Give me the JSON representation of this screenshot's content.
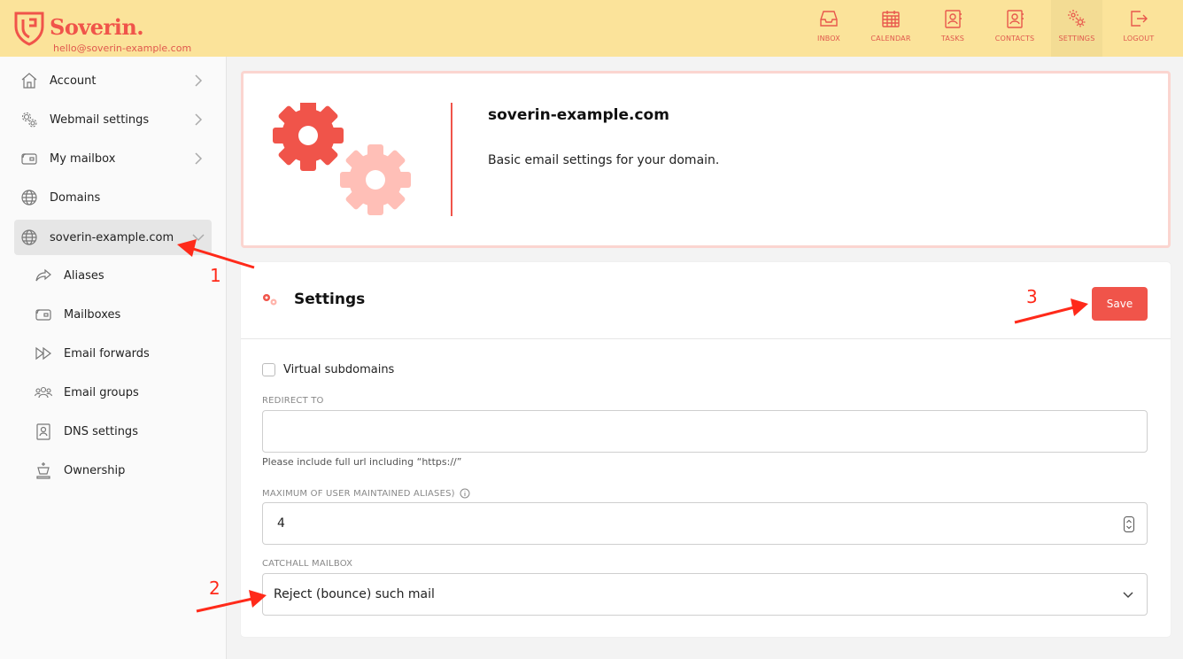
{
  "brand": {
    "name": "Soverin.",
    "email": "hello@soverin-example.com",
    "color": "#f0544a"
  },
  "nav": [
    {
      "label": "INBOX",
      "icon": "inbox-icon"
    },
    {
      "label": "CALENDAR",
      "icon": "calendar-icon"
    },
    {
      "label": "TASKS",
      "icon": "tasks-icon"
    },
    {
      "label": "CONTACTS",
      "icon": "contacts-icon"
    },
    {
      "label": "SETTINGS",
      "icon": "settings-icon",
      "active": true
    },
    {
      "label": "LOGOUT",
      "icon": "logout-icon"
    }
  ],
  "sidebar": {
    "items": [
      {
        "label": "Account",
        "icon": "home-icon"
      },
      {
        "label": "Webmail settings",
        "icon": "gears-icon"
      },
      {
        "label": "My mailbox",
        "icon": "mailbox-icon"
      },
      {
        "label": "Domains",
        "icon": "globe-icon"
      },
      {
        "label": "soverin-example.com",
        "icon": "globe-icon",
        "active": true
      }
    ],
    "subitems": [
      {
        "label": "Aliases",
        "icon": "share-arrow-icon"
      },
      {
        "label": "Mailboxes",
        "icon": "mailbox-icon"
      },
      {
        "label": "Email forwards",
        "icon": "fast-forward-icon"
      },
      {
        "label": "Email groups",
        "icon": "group-icon"
      },
      {
        "label": "DNS settings",
        "icon": "contact-card-icon"
      },
      {
        "label": "Ownership",
        "icon": "chess-king-icon"
      }
    ]
  },
  "annotations": {
    "one": "1",
    "two": "2",
    "three": "3",
    "color": "#ff2a1a"
  },
  "header": {
    "title": "soverin-example.com",
    "description": "Basic email settings for your domain."
  },
  "settings": {
    "title": "Settings",
    "save_label": "Save",
    "virtual_subdomains_label": "Virtual subdomains",
    "virtual_subdomains_checked": false,
    "redirect_label": "REDIRECT TO",
    "redirect_value": "",
    "redirect_help": "Please include full url including “https://”",
    "max_aliases_label": "MAXIMUM OF USER MAINTAINED ALIASES)",
    "max_aliases_value": "4",
    "catchall_label": "CATCHALL MAILBOX",
    "catchall_value": "Reject (bounce) such mail"
  }
}
